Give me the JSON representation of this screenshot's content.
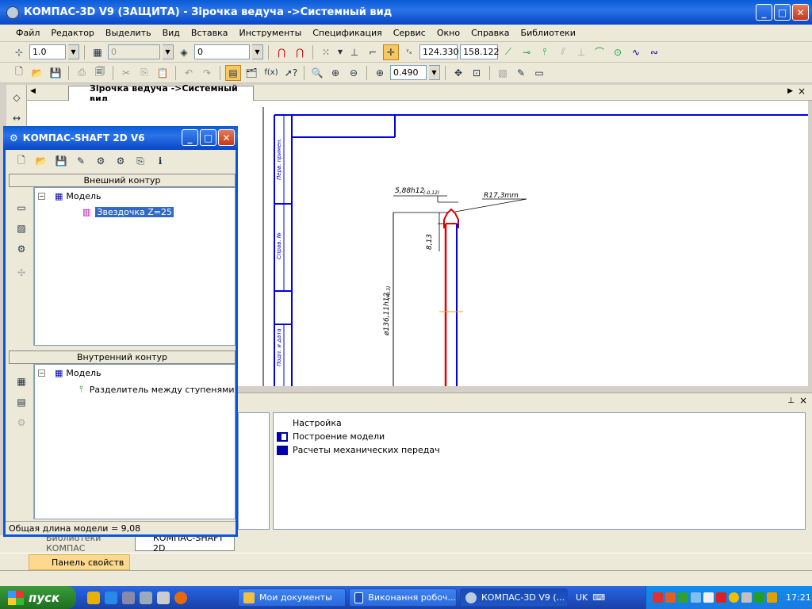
{
  "app": {
    "title": "КОМПАС-3D V9 (ЗАЩИТА) - Зірочка ведуча ->Системный вид"
  },
  "menu": [
    "Файл",
    "Редактор",
    "Выделить",
    "Вид",
    "Вставка",
    "Инструменты",
    "Спецификация",
    "Сервис",
    "Окно",
    "Справка",
    "Библиотеки"
  ],
  "toolbar": {
    "scale_value": "1.0",
    "style_value": "0",
    "layer_value": "0",
    "coord_x": "124.330",
    "coord_y": "158.122",
    "zoom_value": "0.490",
    "fx_label": "f(x)"
  },
  "document": {
    "tab_label": "Зірочка ведуча ->Системный вид"
  },
  "drawing": {
    "dim_top": "5,88h12",
    "dim_top_sub": "(-0,12)",
    "dim_radius": "R17,3mm",
    "dim_height": "8,13",
    "dim_diameter": "ø136,11h12",
    "dim_diameter_sub": "(-0,3)",
    "frame_labels": [
      "Перв. примен.",
      "Справ. №",
      "Подп. и дата"
    ]
  },
  "shaft": {
    "title": "КОМПАС-SHAFT 2D V6",
    "outer_header": "Внешний контур",
    "inner_header": "Внутренний контур",
    "outer_tree": {
      "root": "Модель",
      "child": "Звездочка Z=25"
    },
    "inner_tree": {
      "root": "Модель",
      "child": "Разделитель между ступенями"
    },
    "status": "Общая длина модели = 9,08"
  },
  "library_panel": {
    "items": [
      "Настройка",
      "Построение модели",
      "Расчеты механических передач"
    ]
  },
  "bottom_tabs": [
    "Библиотеки КОМПАС",
    "КОМПАС-SHAFT 2D"
  ],
  "properties_label": "Панель свойств",
  "taskbar": {
    "start_label": "пуск",
    "tasks": [
      "Мои документы",
      "Виконання робоч...",
      "КОМПАС-3D V9 (..."
    ],
    "lang": "UK",
    "clock": "17:21"
  },
  "colors": {
    "titlebar": "#0a5bd6",
    "accent_red": "#e00000",
    "accent_blue": "#0000e0"
  }
}
